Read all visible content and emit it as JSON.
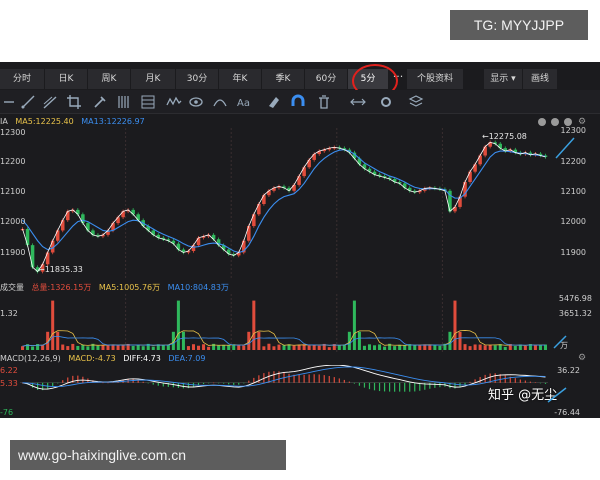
{
  "watermarks": {
    "top": "TG: MYYJJPP",
    "bottom": "www.go-haixinglive.com.cn",
    "zhihu": "知乎 @无尘"
  },
  "tabs": [
    {
      "label": "分时"
    },
    {
      "label": "日K"
    },
    {
      "label": "周K"
    },
    {
      "label": "月K"
    },
    {
      "label": "30分"
    },
    {
      "label": "年K"
    },
    {
      "label": "季K"
    },
    {
      "label": "60分"
    },
    {
      "label": "5分",
      "active": true
    }
  ],
  "tab_more": "···",
  "tab_extra": "个股资料",
  "tab_right": [
    {
      "label": "显示 ▾"
    },
    {
      "label": "画线"
    }
  ],
  "toolbar_icons": [
    "cursor-icon",
    "line-icon",
    "ray-icon",
    "crop-icon",
    "brush-icon",
    "bars-icon",
    "grid-icon",
    "wave-icon",
    "eye-icon",
    "arc-icon",
    "text-icon",
    "eraser-icon",
    "magnet-icon",
    "trash-icon",
    "arrows-icon",
    "settings-icon",
    "layers-icon"
  ],
  "price_panel": {
    "ma5_label": "MA5:12225.40",
    "ma13_label": "MA13:12226.97",
    "y_ticks": [
      "12300",
      "12200",
      "12100",
      "12000",
      "11900"
    ],
    "left_ticks": [
      "12300",
      "12200",
      "12100",
      "12000",
      "11900"
    ],
    "prefix": "IA",
    "high_annotation": "←12275.08",
    "low_annotation": "←11835.33"
  },
  "volume_panel": {
    "title": "成交量",
    "total_label": "总量:1326.15万",
    "ma5_label": "MA5:1005.76万",
    "ma10_label": "MA10:804.83万",
    "y_ticks": [
      "5476.98",
      "3651.32",
      "万"
    ],
    "left_ticks": [
      "1.32"
    ]
  },
  "macd_panel": {
    "title": "MACD(12,26,9)",
    "macd_label": "MACD:-4.73",
    "diff_label": "DIFF:4.73",
    "dea_label": "DEA:7.09",
    "y_ticks": [
      "36.22",
      "-76.44"
    ],
    "left_ticks": [
      "6.22",
      "5.33",
      "-76"
    ]
  },
  "colors": {
    "bg": "#1b1b1e",
    "up": "#e04c3c",
    "down": "#2fb85c",
    "ma5": "#ffffff",
    "ma13": "#3b8ef0",
    "ma10": "#3b8ef0",
    "grid": "#3a2f30",
    "annotation_arrow": "#3aa0e0",
    "highlight": "#e0211d"
  },
  "chart_data": {
    "type": "candlestick",
    "price_series": [
      11980,
      11925,
      11850,
      11835,
      11860,
      11900,
      11940,
      11975,
      12010,
      12040,
      12045,
      12030,
      12000,
      11975,
      11960,
      11955,
      11960,
      11975,
      12000,
      12020,
      12040,
      12045,
      12030,
      12010,
      11990,
      11975,
      11960,
      11950,
      11945,
      11940,
      11930,
      11910,
      11900,
      11905,
      11925,
      11950,
      11955,
      11960,
      11945,
      11925,
      11910,
      11895,
      11890,
      11900,
      11940,
      11990,
      12030,
      12065,
      12095,
      12110,
      12120,
      12125,
      12120,
      12110,
      12130,
      12160,
      12190,
      12215,
      12235,
      12245,
      12250,
      12255,
      12258,
      12255,
      12250,
      12240,
      12220,
      12200,
      12185,
      12175,
      12165,
      12160,
      12155,
      12150,
      12140,
      12135,
      12120,
      12110,
      12105,
      12110,
      12118,
      12120,
      12118,
      12115,
      12110,
      12040,
      12055,
      12090,
      12140,
      12175,
      12200,
      12230,
      12260,
      12275,
      12270,
      12255,
      12245,
      12250,
      12240,
      12235,
      12240,
      12232,
      12236,
      12230,
      12225
    ],
    "ma13_series": [
      12010,
      11990,
      11965,
      11940,
      11920,
      11910,
      11915,
      11930,
      11950,
      11970,
      11990,
      12005,
      12010,
      12005,
      11995,
      11985,
      11975,
      11972,
      11975,
      11985,
      11995,
      12005,
      12010,
      12008,
      12000,
      11990,
      11980,
      11970,
      11962,
      11955,
      11948,
      11940,
      11930,
      11922,
      11918,
      11920,
      11925,
      11930,
      11932,
      11930,
      11925,
      11915,
      11905,
      11900,
      11905,
      11925,
      11955,
      11990,
      12020,
      12045,
      12065,
      12080,
      12090,
      12095,
      12100,
      12115,
      12135,
      12160,
      12185,
      12205,
      12220,
      12232,
      12242,
      12248,
      12250,
      12245,
      12235,
      12220,
      12205,
      12195,
      12185,
      12175,
      12168,
      12160,
      12155,
      12148,
      12140,
      12130,
      12122,
      12118,
      12116,
      12117,
      12117,
      12116,
      12114,
      12095,
      12085,
      12085,
      12100,
      12125,
      12150,
      12175,
      12200,
      12225,
      12240,
      12245,
      12245,
      12243,
      12240,
      12238,
      12236,
      12234,
      12232,
      12230,
      12227
    ],
    "volume_spikes": [
      6,
      31,
      46,
      66,
      86
    ],
    "volume_ylim": [
      0,
      5476.98
    ],
    "price_ylim": [
      11820,
      12310
    ],
    "macd_ylim": [
      -76.44,
      36.22
    ]
  }
}
